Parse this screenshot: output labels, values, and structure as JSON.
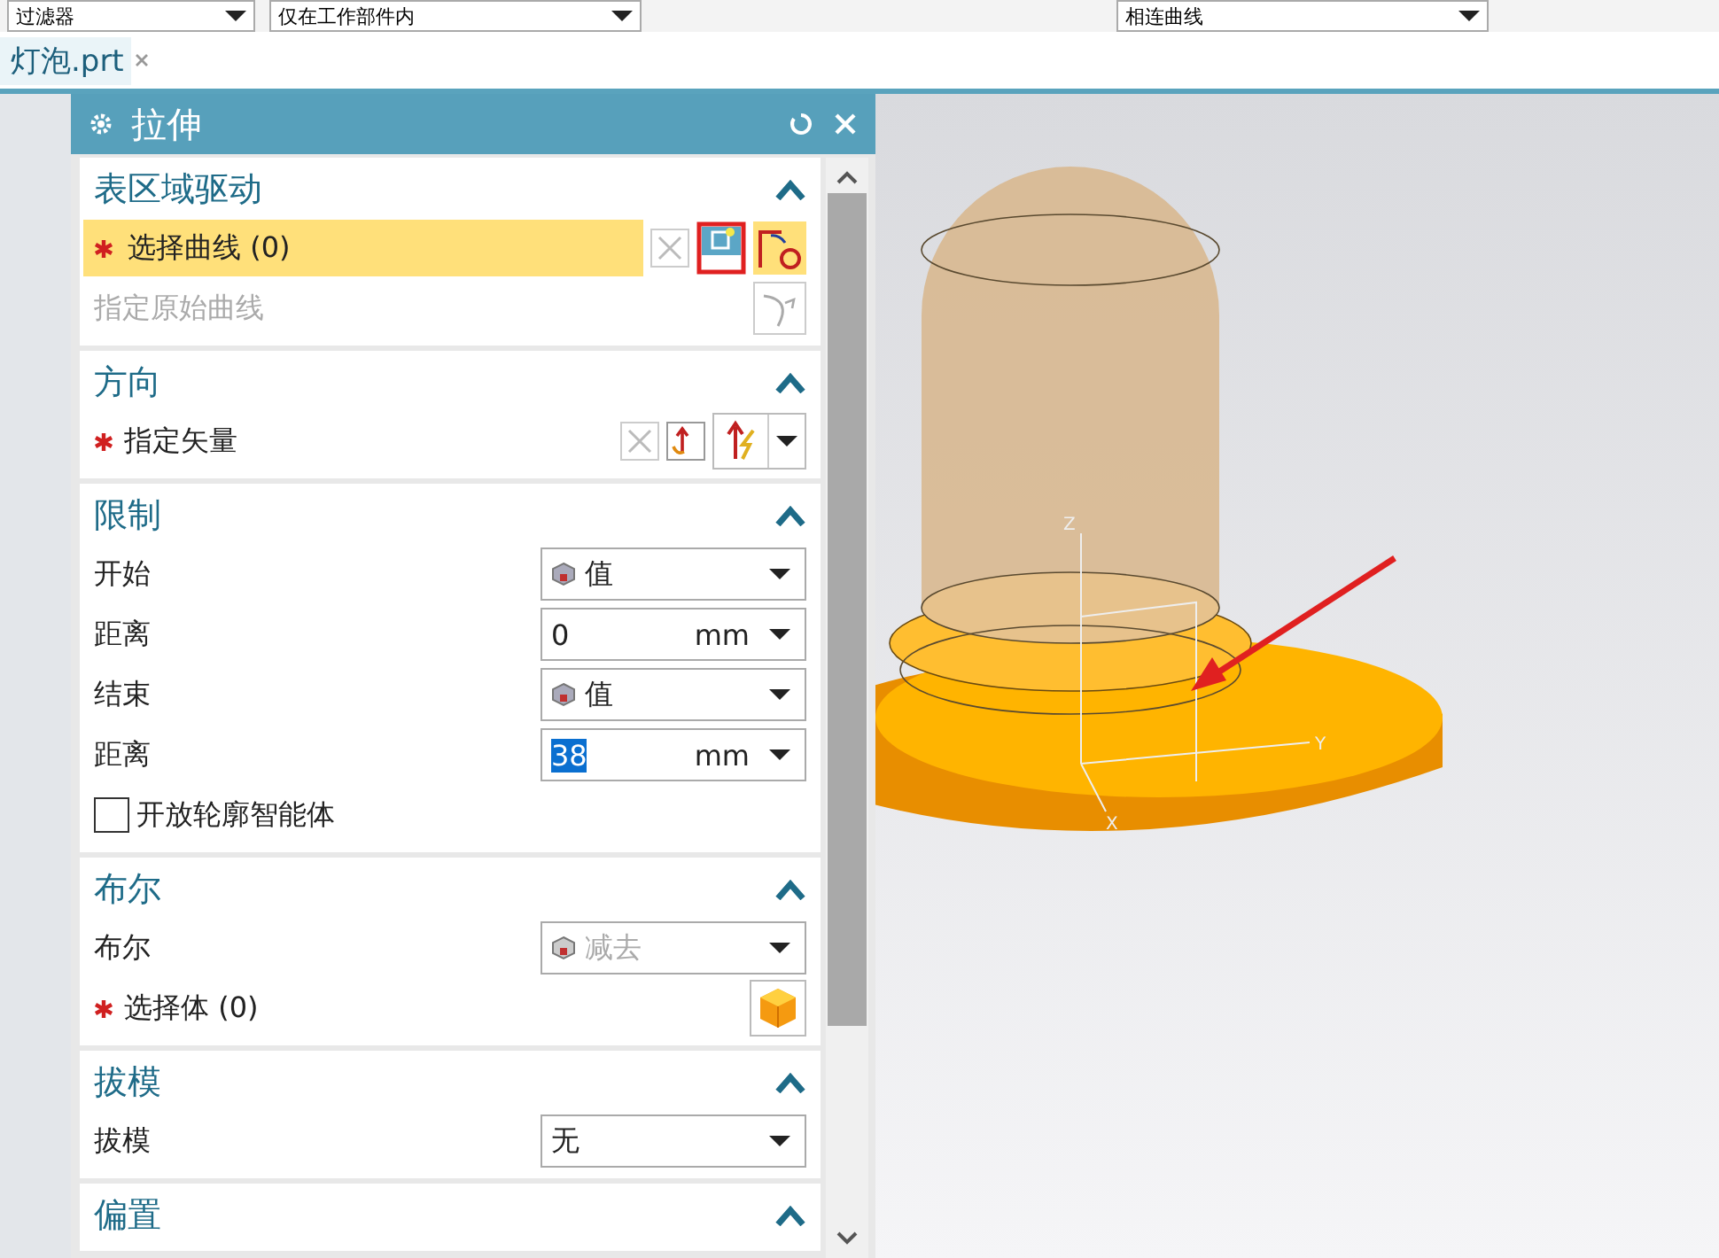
{
  "toolbar": {
    "filters": [
      {
        "value": "过滤器"
      },
      {
        "value": "仅在工作部件内"
      },
      {
        "value": "相连曲线"
      }
    ]
  },
  "tabs": [
    {
      "label": "灯泡.prt",
      "selected": true
    }
  ],
  "dialog": {
    "title": "拉伸",
    "sections": [
      {
        "title": "表区域驱动",
        "expanded": true,
        "rows": [
          {
            "kind": "select",
            "label": "选择曲线 (0)",
            "required": true,
            "highlighted": true,
            "disabled": false,
            "tools": true
          },
          {
            "kind": "select",
            "label": "指定原始曲线",
            "highlighted": false,
            "disabled": true,
            "tools": false
          }
        ]
      },
      {
        "title": "方向",
        "expanded": true,
        "rows": [
          {
            "kind": "vector",
            "label": "指定矢量",
            "required": true
          }
        ]
      },
      {
        "title": "限制",
        "expanded": true,
        "rows": [
          {
            "kind": "dropdown",
            "label": "开始",
            "value": "值",
            "disabled": false,
            "icon": true
          },
          {
            "kind": "number",
            "label": "距离",
            "value": "0",
            "unit": "mm",
            "value_selected": false
          },
          {
            "kind": "dropdown",
            "label": "结束",
            "value": "值",
            "disabled": false,
            "icon": true
          },
          {
            "kind": "number",
            "label": "距离",
            "value": "38",
            "unit": "mm",
            "value_selected": true
          },
          {
            "kind": "checkbox",
            "label": "开放轮廓智能体",
            "checked": false
          }
        ]
      },
      {
        "title": "布尔",
        "expanded": true,
        "rows": [
          {
            "kind": "dropdown",
            "label": "布尔",
            "value": "减去",
            "disabled": true,
            "icon": true
          },
          {
            "kind": "body",
            "label": "选择体 (0)",
            "required": true
          }
        ]
      },
      {
        "title": "拔模",
        "expanded": true,
        "rows": [
          {
            "kind": "dropdown",
            "label": "拔模",
            "value": "无",
            "disabled": false,
            "icon": false
          }
        ]
      },
      {
        "title": "偏置",
        "expanded": true
      }
    ]
  },
  "viewport": {
    "axis_labels": [
      "Z",
      "Y",
      "X"
    ]
  }
}
